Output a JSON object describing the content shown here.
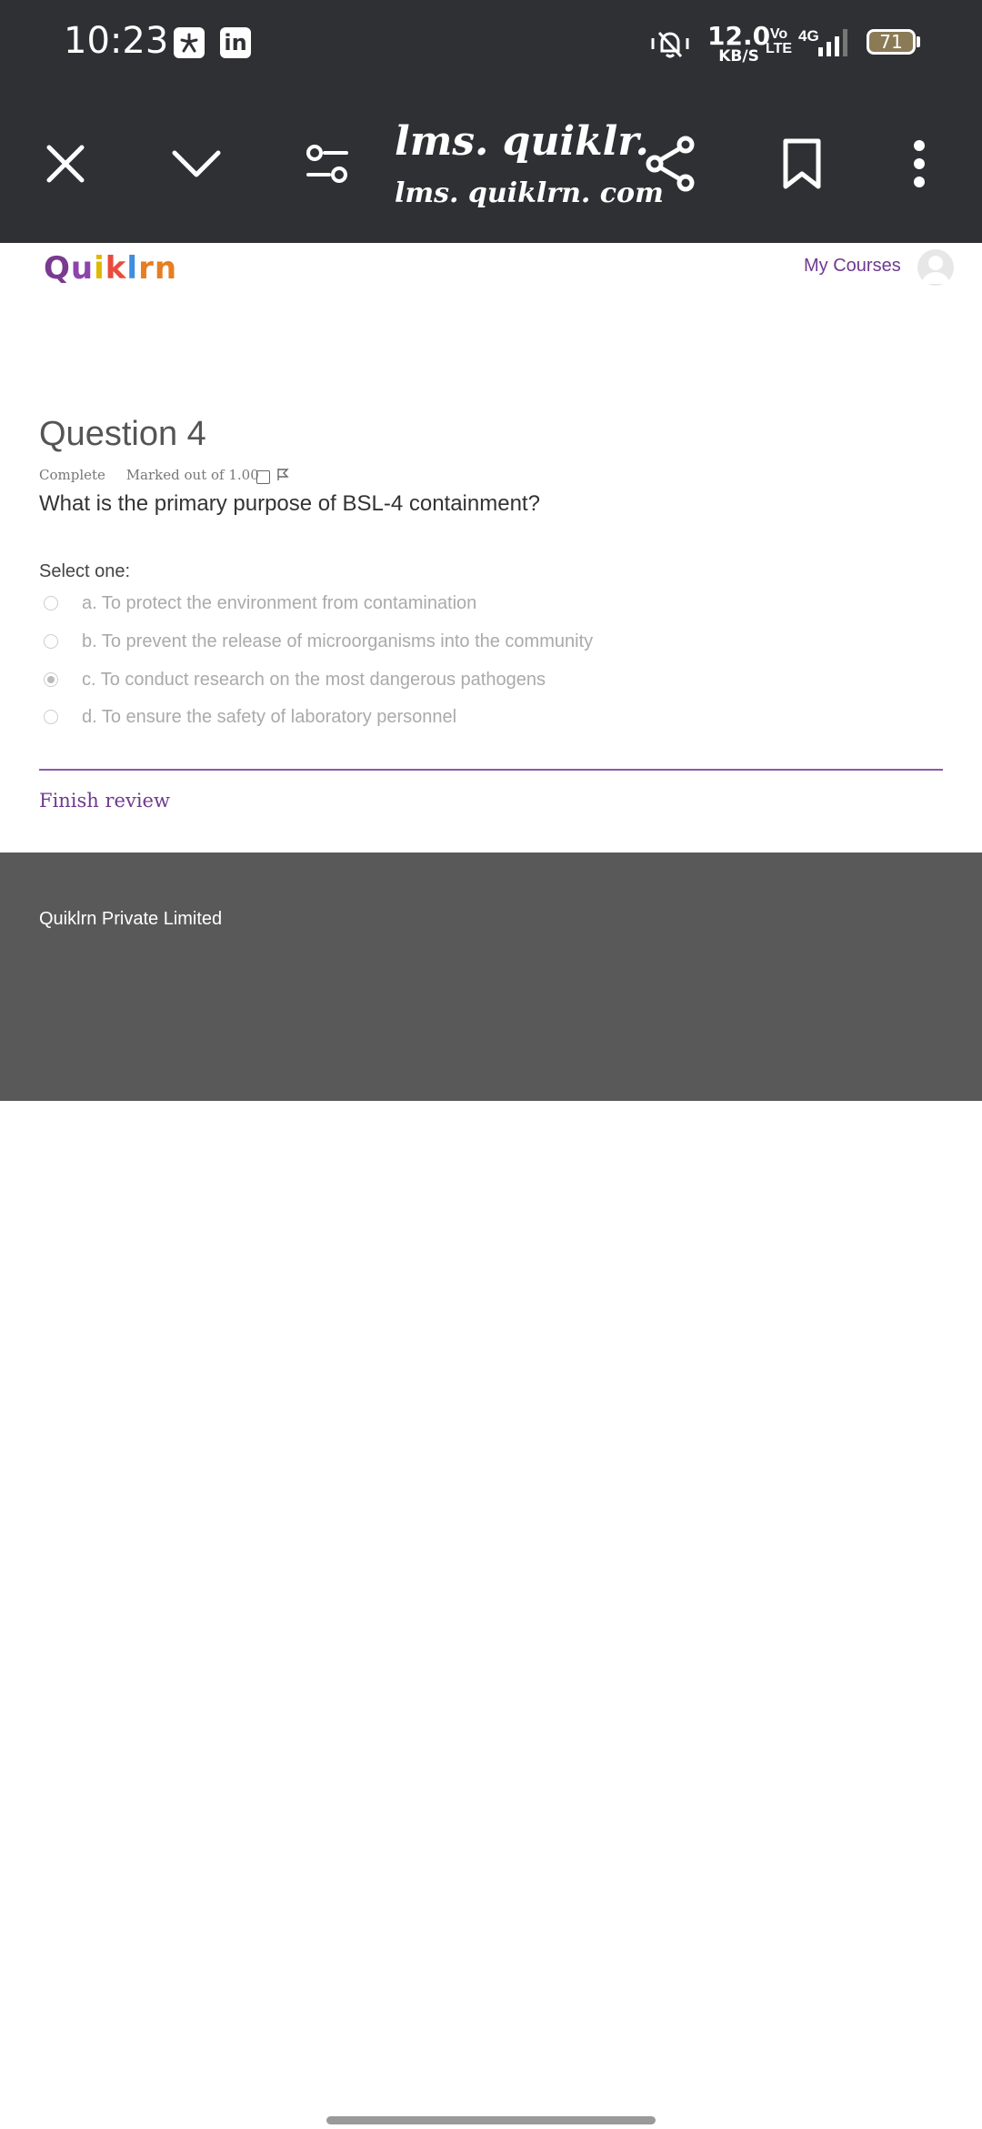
{
  "status_bar": {
    "time": "10:23",
    "app_icons": [
      "Ajio",
      "in"
    ],
    "net_speed_value": "12.0",
    "net_speed_unit": "KB/S",
    "volte_top": "Vo",
    "volte_bottom": "LTE",
    "network": "4G",
    "battery": "71"
  },
  "browser": {
    "title": "lms. quiklr.",
    "host": "lms. quiklrn. com"
  },
  "site": {
    "logo": "Quiklrn",
    "nav_my_courses": "My Courses"
  },
  "question": {
    "title": "Question 4",
    "status": "Complete",
    "marked": "Marked out of 1.00",
    "text": "What is the primary purpose of BSL-4 containment?",
    "select_one": "Select one:",
    "answers": [
      {
        "label": "a. To protect the environment from contamination",
        "selected": false
      },
      {
        "label": "b. To prevent the release of microorganisms into the community",
        "selected": false
      },
      {
        "label": "c. To conduct research on the most dangerous pathogens",
        "selected": true
      },
      {
        "label": "d. To ensure the safety of laboratory personnel",
        "selected": false
      }
    ],
    "finish_review": "Finish review"
  },
  "footer": {
    "company": "Quiklrn Private Limited"
  },
  "colors": {
    "toolbar_bg": "#2f3033",
    "accent_purple": "#6f3a8f",
    "footer_bg": "#595959"
  }
}
